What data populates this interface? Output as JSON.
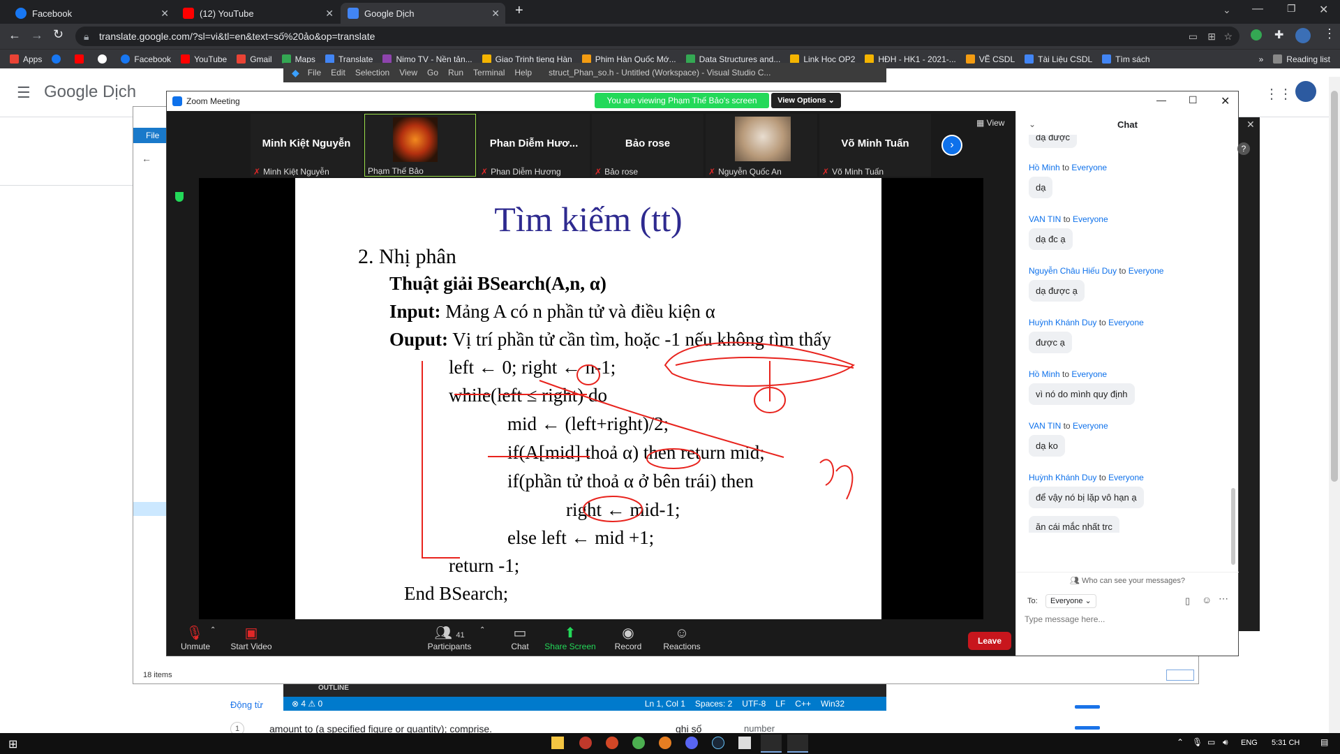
{
  "browser": {
    "tabs": [
      {
        "label": "Facebook",
        "color": "#1877f2"
      },
      {
        "label": "(12) YouTube",
        "color": "#ff0000"
      },
      {
        "label": "Google Dịch",
        "color": "#4285f4"
      }
    ],
    "url": "translate.google.com/?sl=vi&tl=en&text=số%20ảo&op=translate",
    "bookmarks": [
      {
        "label": "Apps",
        "color": "#ea4335"
      },
      {
        "label": "",
        "color": "#1877f2"
      },
      {
        "label": "",
        "color": "#ff0000"
      },
      {
        "label": "",
        "color": "#ffffff"
      },
      {
        "label": "Facebook",
        "color": "#1877f2"
      },
      {
        "label": "YouTube",
        "color": "#ff0000"
      },
      {
        "label": "Gmail",
        "color": "#ea4335"
      },
      {
        "label": "Maps",
        "color": "#34a853"
      },
      {
        "label": "Translate",
        "color": "#4285f4"
      },
      {
        "label": "Nimo TV - Nền tản...",
        "color": "#8e44ad"
      },
      {
        "label": "Giao Trinh tieng Hàn",
        "color": "#f4b400"
      },
      {
        "label": "Phim Hàn Quốc Mớ...",
        "color": "#f39c12"
      },
      {
        "label": "Data Structures and...",
        "color": "#34a853"
      },
      {
        "label": "Link Hoc OP2",
        "color": "#f4b400"
      },
      {
        "label": "HĐH - HK1 - 2021-...",
        "color": "#f4b400"
      },
      {
        "label": "VẼ CSDL",
        "color": "#f39c12"
      },
      {
        "label": "Tài Liệu CSDL",
        "color": "#4285f4"
      },
      {
        "label": "Tìm sách",
        "color": "#4285f4"
      }
    ],
    "more": "»",
    "reading_list": "Reading list"
  },
  "translate": {
    "logo": "Google Dịch",
    "bottom_verb": "Động từ",
    "bottom_num": "1",
    "bottom_def": "amount to (a specified figure or quantity); comprise.",
    "bottom_word": "ghi số",
    "bottom_word_en": "number"
  },
  "vscode": {
    "menu": [
      "File",
      "Edit",
      "Selection",
      "View",
      "Go",
      "Run",
      "Terminal",
      "Help"
    ],
    "title": "struct_Phan_so.h - Untitled (Workspace) - Visual Studio C...",
    "outline": "OUTLINE",
    "status_left": "⊗ 4 ⚠ 0",
    "status_right": [
      "Ln 1, Col 1",
      "Spaces: 2",
      "UTF-8",
      "LF",
      "C++",
      "Win32"
    ]
  },
  "explorer": {
    "file_tab": "File",
    "items_count": "18 items"
  },
  "zoom": {
    "window_title": "Zoom Meeting",
    "viewing_banner": "You are viewing Phạm Thế Bảo's screen",
    "view_options": "View Options",
    "view_btn": "View",
    "participants": [
      {
        "name": "Minh Kiệt Nguyễn",
        "sub": "Minh Kiệt Nguyễn"
      },
      {
        "name": "",
        "sub": "Phạm Thế Bảo"
      },
      {
        "name": "Phan Diễm Hươ...",
        "sub": "Phan Diễm Hương"
      },
      {
        "name": "Bảo rose",
        "sub": "Bảo rose"
      },
      {
        "name": "",
        "sub": "Nguyễn Quốc An"
      },
      {
        "name": "Võ Minh Tuấn",
        "sub": "Võ Minh Tuấn"
      }
    ],
    "toolbar": {
      "unmute": "Unmute",
      "start_video": "Start Video",
      "participants": "Participants",
      "participants_count": "41",
      "chat": "Chat",
      "share": "Share Screen",
      "record": "Record",
      "reactions": "Reactions",
      "leave": "Leave"
    }
  },
  "slide": {
    "title": "Tìm kiếm (tt)",
    "lines": [
      "2.   Nhị phân",
      "Thuật giải BSearch(A,n, α)",
      "Input:",
      " Mảng A có n phần tử và điều kiện α",
      "Ouput:",
      " Vị trí phần tử cần tìm, hoặc -1 nếu không tìm thấy",
      "left ← 0; right ← n-1;",
      "while(left ≤ right) do",
      "mid ← (left+right)/2;",
      "if(A[mid] thoả α) then return mid;",
      "if(phần tử thoả α ở bên trái) then",
      "right ← mid-1;",
      "else left ← mid +1;",
      "return -1;",
      "End BSearch;"
    ]
  },
  "chat": {
    "header": "Chat",
    "messages": [
      {
        "from": "",
        "to": "",
        "text": "dạ được"
      },
      {
        "from": "Hồ Minh",
        "to": "Everyone",
        "text": "dạ"
      },
      {
        "from": "VAN TIN",
        "to": "Everyone",
        "text": "dạ đc ạ"
      },
      {
        "from": "Nguyễn Châu Hiếu Duy",
        "to": "Everyone",
        "text": "dạ được ạ"
      },
      {
        "from": "Huỳnh Khánh Duy",
        "to": "Everyone",
        "text": "được ạ"
      },
      {
        "from": "Hồ Minh",
        "to": "Everyone",
        "text": "vì nó do mình quy định"
      },
      {
        "from": "VAN TIN",
        "to": "Everyone",
        "text": "dạ ko"
      },
      {
        "from": "Huỳnh Khánh Duy",
        "to": "Everyone",
        "text": "để vậy nó bị lặp vô hạn ạ"
      },
      {
        "from": "",
        "to": "",
        "text": "ăn cái mắc nhất trc"
      }
    ],
    "to_word": "to",
    "who_can_see": "Who can see your messages?",
    "to_label": "To:",
    "to_value": "Everyone",
    "input_placeholder": "Type message here..."
  },
  "taskbar": {
    "lang": "ENG",
    "time": "5:31 CH"
  }
}
